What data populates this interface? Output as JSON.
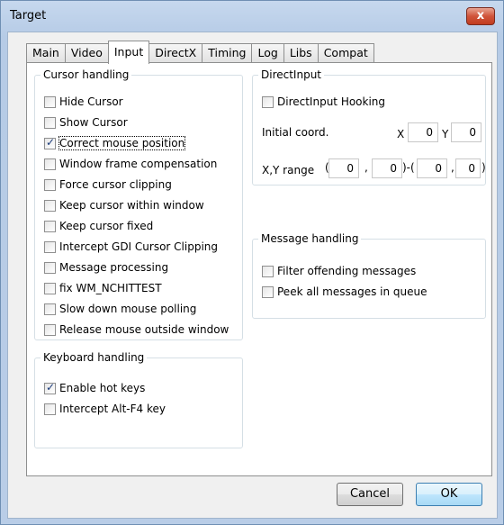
{
  "window": {
    "title": "Target",
    "close_label": "x"
  },
  "tabs": [
    "Main",
    "Video",
    "Input",
    "DirectX",
    "Timing",
    "Log",
    "Libs",
    "Compat"
  ],
  "active_tab": "Input",
  "cursor_group": {
    "label": "Cursor handling",
    "items": [
      {
        "label": "Hide Cursor",
        "checked": false
      },
      {
        "label": "Show Cursor",
        "checked": false
      },
      {
        "label": "Correct mouse position",
        "checked": true
      },
      {
        "label": "Window frame compensation",
        "checked": false
      },
      {
        "label": "Force cursor clipping",
        "checked": false
      },
      {
        "label": "Keep cursor within window",
        "checked": false
      },
      {
        "label": "Keep cursor fixed",
        "checked": false
      },
      {
        "label": "Intercept GDI Cursor Clipping",
        "checked": false
      },
      {
        "label": "Message processing",
        "checked": false
      },
      {
        "label": "fix WM_NCHITTEST",
        "checked": false
      },
      {
        "label": "Slow down mouse polling",
        "checked": false
      },
      {
        "label": "Release mouse outside window",
        "checked": false
      }
    ]
  },
  "keyboard_group": {
    "label": "Keyboard handling",
    "items": [
      {
        "label": "Enable hot keys",
        "checked": true
      },
      {
        "label": "Intercept Alt-F4 key",
        "checked": false
      }
    ]
  },
  "directinput_group": {
    "label": "DirectInput",
    "hooking_label": "DirectInput Hooking",
    "hooking_checked": false,
    "initial_coord_label": "Initial coord.",
    "x_label": "X",
    "y_label": "Y",
    "initial_x": "0",
    "initial_y": "0",
    "range_label": "X,Y range",
    "range_open": "(",
    "range_comma1": ",",
    "range_sep": ")-(",
    "range_comma2": ",",
    "range_close": ")",
    "range_x1": "0",
    "range_y1": "0",
    "range_x2": "0",
    "range_y2": "0"
  },
  "message_group": {
    "label": "Message handling",
    "items": [
      {
        "label": "Filter offending messages",
        "checked": false
      },
      {
        "label": "Peek all messages in queue",
        "checked": false
      }
    ]
  },
  "buttons": {
    "cancel": "Cancel",
    "ok": "OK"
  }
}
